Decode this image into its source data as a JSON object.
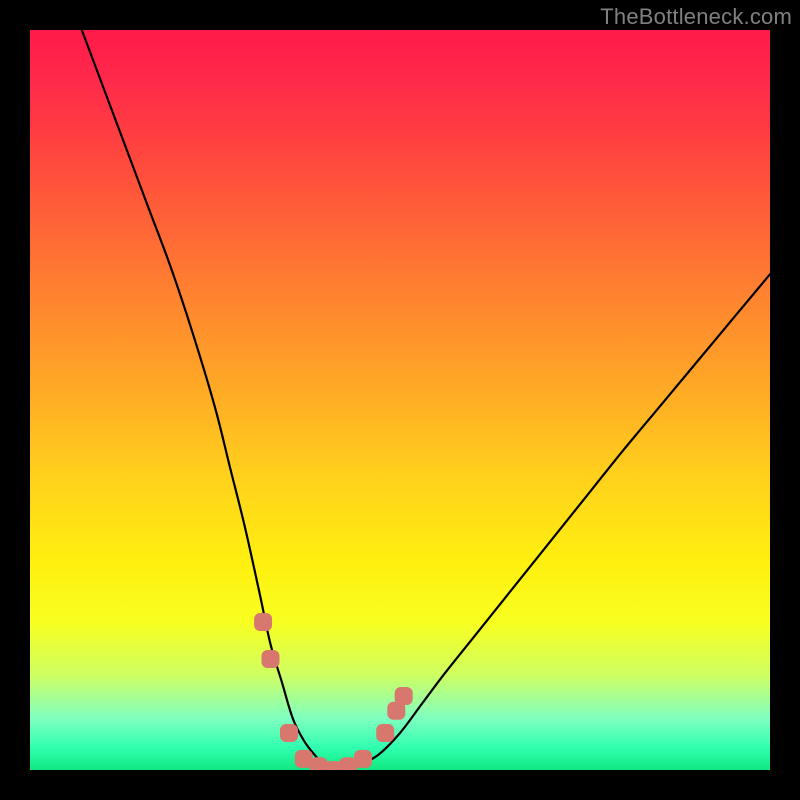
{
  "watermark": "TheBottleneck.com",
  "chart_data": {
    "type": "line",
    "title": "",
    "xlabel": "",
    "ylabel": "",
    "xlim": [
      0,
      100
    ],
    "ylim": [
      0,
      100
    ],
    "series": [
      {
        "name": "curve",
        "x": [
          7,
          10,
          13,
          16,
          19,
          22,
          25,
          27,
          29,
          31,
          32.5,
          34,
          35.5,
          37,
          38.5,
          40,
          42,
          44,
          47,
          50,
          53,
          56,
          60,
          64,
          68,
          72,
          76,
          80,
          85,
          90,
          95,
          100
        ],
        "y": [
          100,
          92,
          84,
          76,
          68,
          59,
          49,
          41,
          33,
          24,
          17,
          12,
          7,
          4,
          2,
          0.5,
          0,
          0.5,
          2,
          5,
          9,
          13,
          18,
          23,
          28,
          33,
          38,
          43,
          49,
          55,
          61,
          67
        ]
      }
    ],
    "markers": {
      "name": "highlight-points",
      "color": "#d8776e",
      "points": [
        {
          "x": 31.5,
          "y": 20
        },
        {
          "x": 32.5,
          "y": 15
        },
        {
          "x": 35,
          "y": 5
        },
        {
          "x": 37,
          "y": 1.5
        },
        {
          "x": 39,
          "y": 0.5
        },
        {
          "x": 41,
          "y": 0
        },
        {
          "x": 43,
          "y": 0.5
        },
        {
          "x": 45,
          "y": 1.5
        },
        {
          "x": 48,
          "y": 5
        },
        {
          "x": 49.5,
          "y": 8
        },
        {
          "x": 50.5,
          "y": 10
        }
      ]
    },
    "gradient_stops": [
      {
        "pos": 0,
        "color": "#ff1a4a"
      },
      {
        "pos": 50,
        "color": "#ffb020"
      },
      {
        "pos": 80,
        "color": "#f8ff20"
      },
      {
        "pos": 100,
        "color": "#10e880"
      }
    ]
  }
}
